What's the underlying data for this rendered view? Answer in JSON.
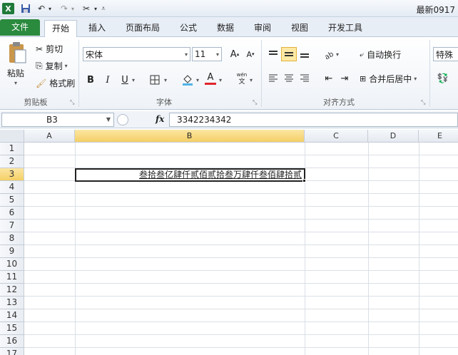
{
  "titlebar": {
    "title": "最新0917"
  },
  "tabs": [
    {
      "label": "文件"
    },
    {
      "label": "开始"
    },
    {
      "label": "插入"
    },
    {
      "label": "页面布局"
    },
    {
      "label": "公式"
    },
    {
      "label": "数据"
    },
    {
      "label": "审阅"
    },
    {
      "label": "视图"
    },
    {
      "label": "开发工具"
    }
  ],
  "clipboard": {
    "paste": "粘贴",
    "cut": "剪切",
    "copy": "复制",
    "format_painter": "格式刷",
    "group": "剪贴板"
  },
  "font": {
    "name": "宋体",
    "size": "11",
    "bold": "B",
    "italic": "I",
    "underline": "U",
    "color_a": "A",
    "group": "字体"
  },
  "alignment": {
    "wrap": "自动换行",
    "merge": "合并后居中",
    "group": "对齐方式"
  },
  "number": {
    "format": "特殊"
  },
  "formula_bar": {
    "name_box": "B3",
    "fx": "fx",
    "value": "3342234342"
  },
  "grid": {
    "columns": [
      "A",
      "B",
      "C",
      "D",
      "E"
    ],
    "rows": [
      "1",
      "2",
      "3",
      "4",
      "5",
      "6",
      "7",
      "8",
      "9",
      "10",
      "11",
      "12",
      "13",
      "14",
      "15",
      "16",
      "17"
    ],
    "active_cell_text": "叁拾叁亿肆仟贰佰贰拾叁万肆仟叁佰肆拾贰"
  },
  "colors": {
    "file_tab": "#2a8a3e",
    "selection": "#f5cf66"
  }
}
